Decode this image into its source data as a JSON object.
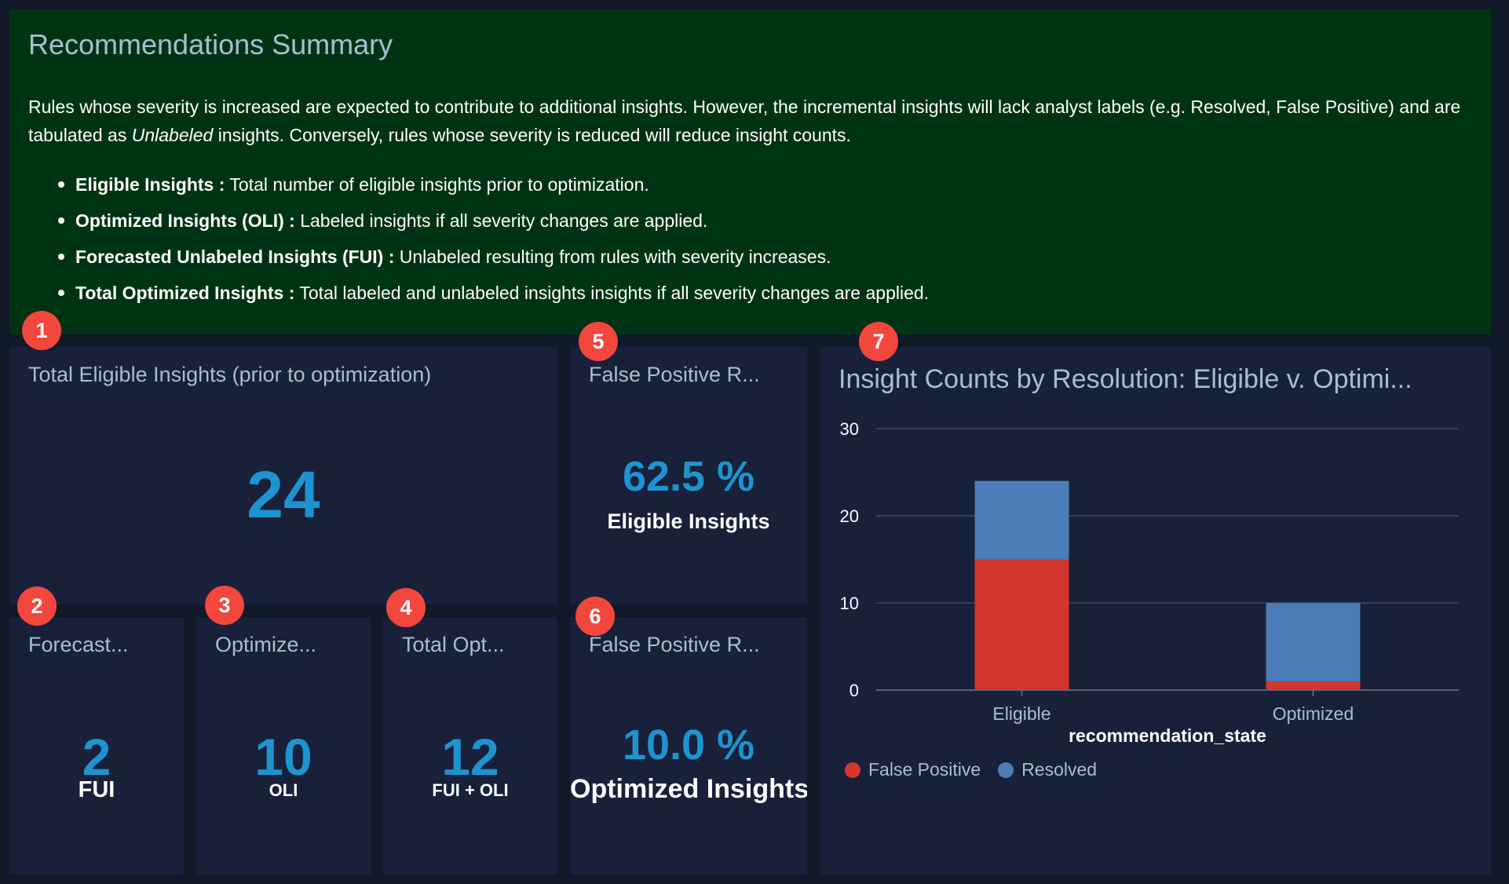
{
  "summary": {
    "title": "Recommendations Summary",
    "para_part1": "Rules whose severity is increased are expected to contribute to additional insights. However, the incremental insights will lack analyst labels (e.g. Resolved, False Positive) and are tabulated as ",
    "para_italic": "Unlabeled",
    "para_part2": " insights. Conversely, rules whose severity is reduced will reduce insight counts.",
    "items": [
      {
        "term": "Eligible Insights :",
        "desc": " Total number of eligible insights prior to optimization."
      },
      {
        "term": "Optimized Insights (OLI) :",
        "desc": " Labeled insights if all severity changes are applied."
      },
      {
        "term": "Forecasted Unlabeled Insights (FUI) :",
        "desc": " Unlabeled resulting from rules with severity increases."
      },
      {
        "term": "Total Optimized Insights :",
        "desc": " Total labeled and unlabeled insights insights if all severity changes are applied."
      }
    ]
  },
  "badges": [
    "1",
    "2",
    "3",
    "4",
    "5",
    "6",
    "7"
  ],
  "panels": {
    "total_eligible": {
      "title": "Total Eligible Insights (prior to optimization)",
      "value": "24"
    },
    "forecasted": {
      "title": "Forecast...",
      "value": "2",
      "label": "FUI"
    },
    "optimized": {
      "title": "Optimize...",
      "value": "10",
      "label": "OLI"
    },
    "total_opt": {
      "title": "Total Opt...",
      "value": "12",
      "label": "FUI + OLI"
    },
    "fp_eligible": {
      "title": "False Positive R...",
      "value": "62.5 %",
      "label": "Eligible Insights"
    },
    "fp_optimized": {
      "title": "False Positive R...",
      "value": "10.0 %",
      "label": "Optimized Insights"
    }
  },
  "chart_panel": {
    "title": "Insight Counts by Resolution: Eligible v. Optimi..."
  },
  "chart_data": {
    "type": "bar",
    "stacked": true,
    "categories": [
      "Eligible",
      "Optimized"
    ],
    "series": [
      {
        "name": "False Positive",
        "values": [
          15,
          1
        ],
        "color": "#d1372d"
      },
      {
        "name": "Resolved",
        "values": [
          9,
          9
        ],
        "color": "#4d7db8"
      }
    ],
    "xlabel": "recommendation_state",
    "ylabel": "",
    "ylim": [
      0,
      30
    ],
    "yticks": [
      0,
      10,
      20,
      30
    ],
    "grid": true,
    "legend": "bottom-left"
  }
}
